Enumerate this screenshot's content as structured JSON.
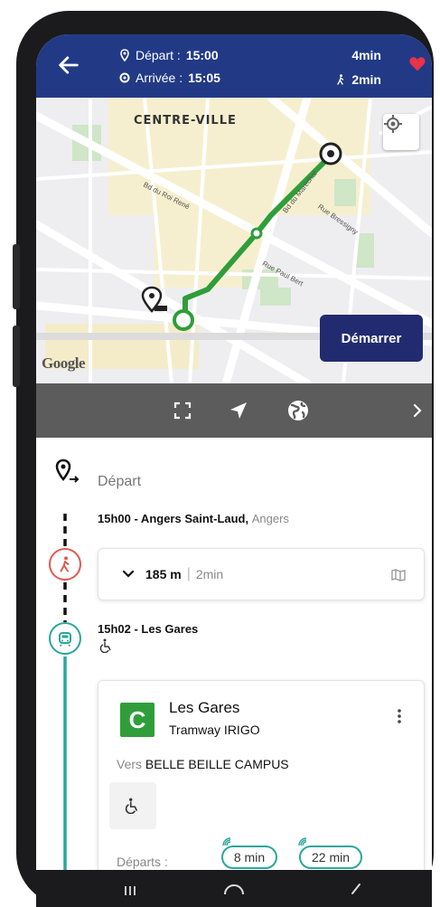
{
  "header": {
    "depart_label": "Départ :",
    "depart_time": "15:00",
    "arrivee_label": "Arrivée :",
    "arrivee_time": "15:05",
    "duration": "4min",
    "walk_duration": "2min"
  },
  "map": {
    "area_label": "CENTRE-VILLE",
    "streets": [
      "Bd du Roi René",
      "Rue Bressigny",
      "Rue Paul Bert",
      "Bd du Maréchal"
    ],
    "start_button": "Démarrer",
    "provider": "Google"
  },
  "itinerary": {
    "start_label": "Départ",
    "step1_time_place": "15h00 - Angers Saint-Laud,",
    "step1_city": "Angers",
    "walk_distance": "185 m",
    "walk_time": "2min",
    "step2_time_place": "15h02 - Les Gares",
    "line_letter": "C",
    "stop_name": "Les Gares",
    "line_name": "Tramway IRIGO",
    "direction_label": "Vers",
    "direction": "BELLE BEILLE CAMPUS",
    "departures_label": "Départs :",
    "departures": [
      "8 min",
      "22 min"
    ]
  },
  "colors": {
    "header_bg": "#223a86",
    "route_green": "#2f9e3a",
    "walk_red": "#e05a4f",
    "tram_teal": "#2aa79b",
    "heart": "#e8334a",
    "start_button_bg": "#222b6f"
  }
}
